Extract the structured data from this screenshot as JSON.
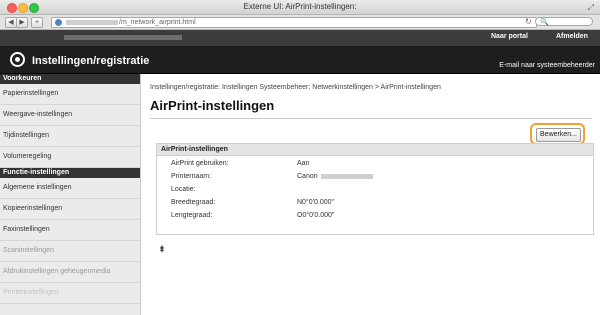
{
  "window": {
    "title": "Externe UI: AirPrint-instellingen:",
    "url_path": "/m_network_airprint.html"
  },
  "banner": {
    "portal_link": "Naar portal",
    "logout_link": "Afmelden",
    "app_title": "Instellingen/registratie",
    "admin_mail_link": "E-mail naar systeembeheerder"
  },
  "sidebar": {
    "group1_title": "Voorkeuren",
    "group1_items": [
      "Papierinstellingen",
      "Weergave-instellingen",
      "Tijdinstellingen",
      "Volumeregeling"
    ],
    "group2_title": "Functie-instellingen",
    "group2_items": [
      "Algemene instellingen",
      "Kopieerinstellingen",
      "Faxinstellingen",
      "Scaninstellingen",
      "Afdrukinstellingen geheugenmedia",
      "Printerinstellingen"
    ]
  },
  "content": {
    "breadcrumb": "Instellingen/registratie: Instellingen Systeembeheer: Netwerkinstellingen > AirPrint-instellingen",
    "page_title": "AirPrint-instellingen",
    "edit_button": "Bewerken...",
    "section_title": "AirPrint-instellingen",
    "fields": [
      {
        "label": "AirPrint gebruiken:",
        "value": "Aan"
      },
      {
        "label": "Printernaam:",
        "value": "Canon"
      },
      {
        "label": "Locatie:",
        "value": ""
      },
      {
        "label": "Breedtegraad:",
        "value": "N0°0'0.000\""
      },
      {
        "label": "Lengtegraad:",
        "value": "O0°0'0.000\""
      }
    ],
    "back_to_top": "⯒"
  },
  "colors": {
    "header_bg": "#1e1e1e",
    "top_banner_bg": "#3c3c3c",
    "highlight_ring": "#f2a12f",
    "sidebar_bg": "#ebebeb",
    "section_head_bg": "#e4e4e4"
  },
  "icons": {
    "header_icon": "gear-icon",
    "back_to_top_icon": "arrow-up-to-top-icon",
    "address_icon": "globe-icon"
  }
}
